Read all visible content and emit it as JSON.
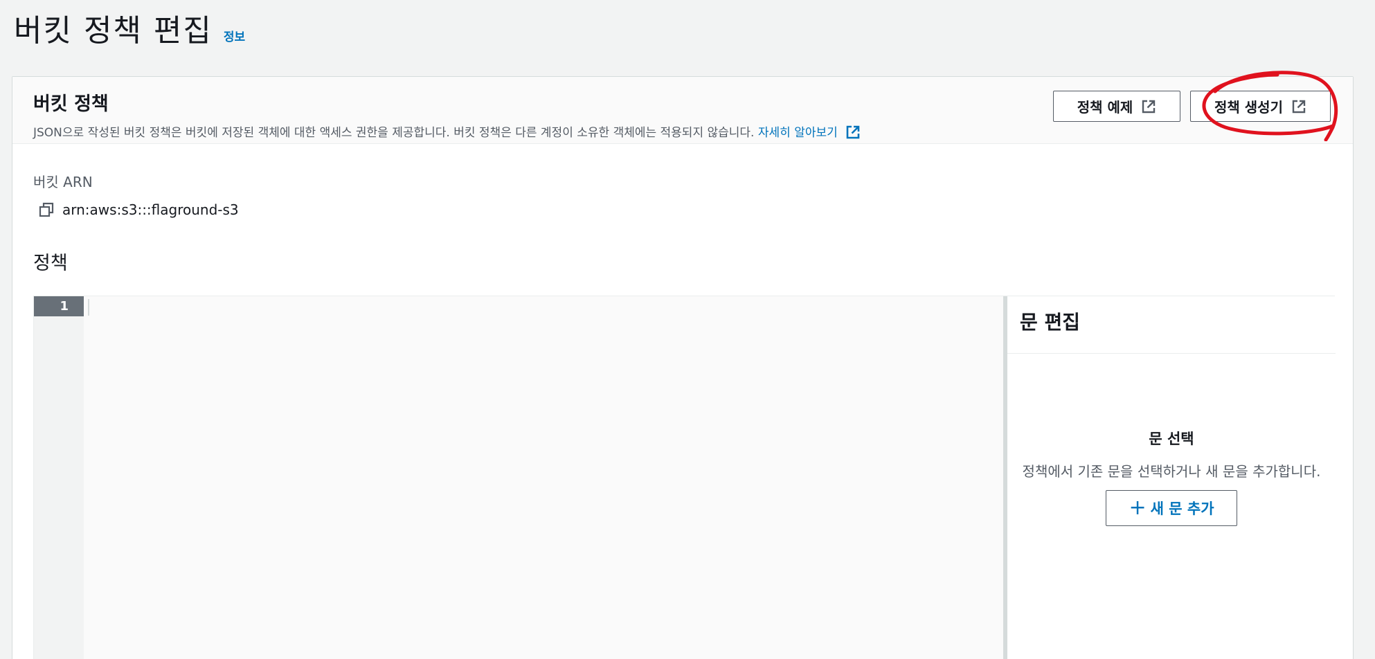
{
  "page": {
    "title": "버킷 정책 편집",
    "info_link": "정보"
  },
  "panel": {
    "title": "버킷 정책",
    "description": "JSON으로 작성된 버킷 정책은 버킷에 저장된 객체에 대한 액세스 권한을 제공합니다. 버킷 정책은 다른 계정이 소유한 객체에는 적용되지 않습니다.",
    "learn_more": "자세히 알아보기",
    "buttons": {
      "policy_examples": "정책 예제",
      "policy_generator": "정책 생성기"
    }
  },
  "arn": {
    "label": "버킷 ARN",
    "value": "arn:aws:s3:::flaground-s3"
  },
  "policy": {
    "label": "정책",
    "editor": {
      "line_numbers": [
        "1"
      ],
      "content": ""
    }
  },
  "statement_panel": {
    "title": "문 편집",
    "select_title": "문 선택",
    "select_desc": "정책에서 기존 문을 선택하거나 새 문을 추가합니다.",
    "add_button": "새 문 추가"
  },
  "colors": {
    "link": "#0073bb",
    "annotation": "#e0121e",
    "gutter_active": "#687078"
  },
  "icons": {
    "external": "external-link-icon",
    "copy": "copy-icon",
    "plus": "plus-icon"
  }
}
